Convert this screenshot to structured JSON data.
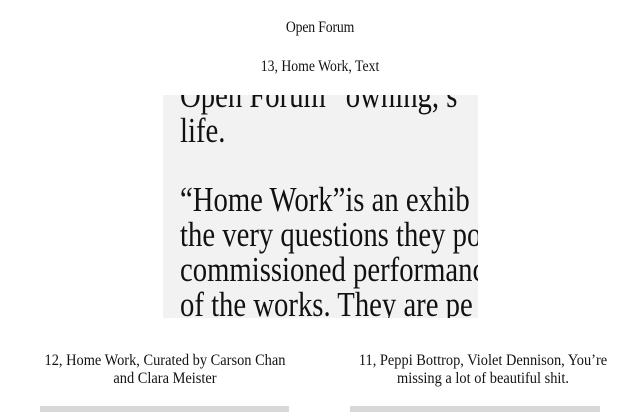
{
  "site": {
    "title": "Open Forum"
  },
  "post": {
    "title": "13, Home Work, Text"
  },
  "preview": {
    "lines": [
      "Open Forum “owning, s",
      "life.",
      "",
      "“Home Work”is an exhib",
      "the very questions they po",
      "commissioned performanc",
      "of  the works. They are pe"
    ]
  },
  "related": [
    {
      "caption": "12, Home Work, Curated by Carson Chan and Clara Meister"
    },
    {
      "caption": "11, Peppi Bottrop, Violet Dennison, You’re missing a lot of  beautiful shit."
    }
  ],
  "colors": {
    "text": "#111111",
    "preview_background": "#f2f2f2",
    "thumbnail": "#d8d8d8"
  }
}
